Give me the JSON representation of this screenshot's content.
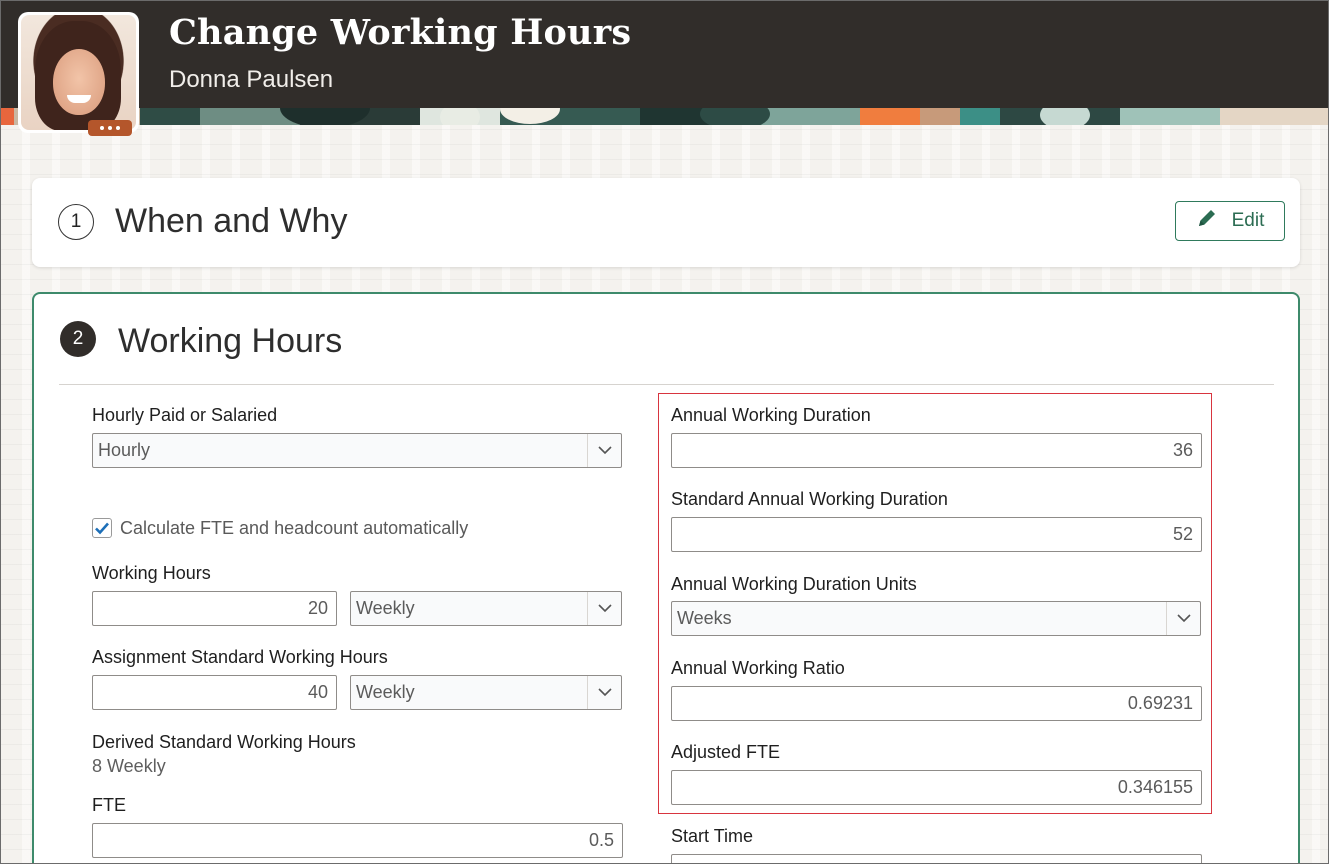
{
  "header": {
    "title": "Change Working Hours",
    "person_name": "Donna Paulsen"
  },
  "sections": {
    "when_why": {
      "number": "1",
      "title": "When and Why",
      "edit_label": "Edit"
    },
    "working_hours": {
      "number": "2",
      "title": "Working Hours"
    }
  },
  "form": {
    "hourly_paid": {
      "label": "Hourly Paid or Salaried",
      "value": "Hourly"
    },
    "calc_fte": {
      "label": "Calculate FTE and headcount automatically",
      "checked": true
    },
    "working_hours": {
      "label": "Working Hours",
      "value": "20",
      "frequency": "Weekly"
    },
    "assignment_standard": {
      "label": "Assignment Standard Working Hours",
      "value": "40",
      "frequency": "Weekly"
    },
    "derived_standard": {
      "label": "Derived Standard Working Hours",
      "value": "8 Weekly"
    },
    "fte": {
      "label": "FTE",
      "value": "0.5"
    },
    "annual_working_duration": {
      "label": "Annual Working Duration",
      "value": "36"
    },
    "standard_annual_working_duration": {
      "label": "Standard Annual Working Duration",
      "value": "52"
    },
    "annual_working_duration_units": {
      "label": "Annual Working Duration Units",
      "value": "Weeks"
    },
    "annual_working_ratio": {
      "label": "Annual Working Ratio",
      "value": "0.69231"
    },
    "adjusted_fte": {
      "label": "Adjusted FTE",
      "value": "0.346155"
    },
    "start_time": {
      "label": "Start Time"
    }
  },
  "colors": {
    "header_bg": "#312d2a",
    "accent_green": "#3d8a6b",
    "highlight_red": "#d8353f",
    "checkbox_blue": "#1d6fb8"
  }
}
